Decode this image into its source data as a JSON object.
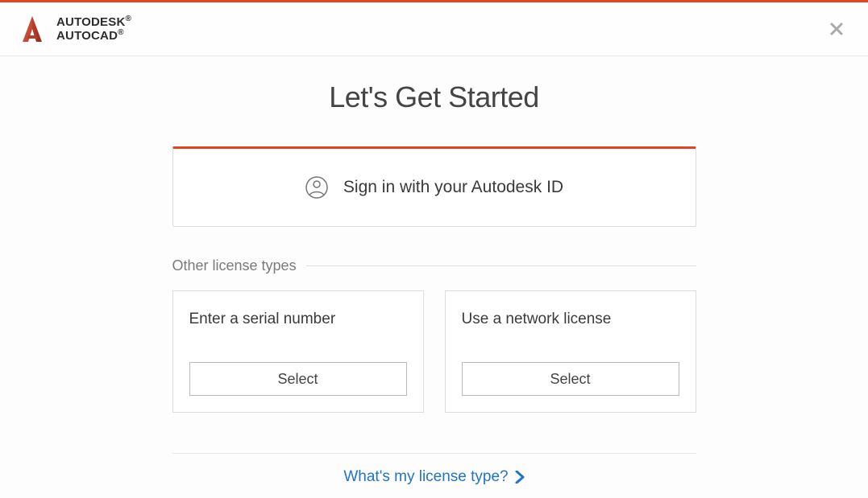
{
  "brand": {
    "line1": "AUTODESK",
    "line2": "AUTOCAD"
  },
  "title": "Let's Get Started",
  "signin_label": "Sign in with your Autodesk ID",
  "section_label": "Other license types",
  "cards": {
    "serial": {
      "title": "Enter a serial number",
      "button": "Select"
    },
    "network": {
      "title": "Use a network license",
      "button": "Select"
    }
  },
  "footer_link": "What's my license type?"
}
